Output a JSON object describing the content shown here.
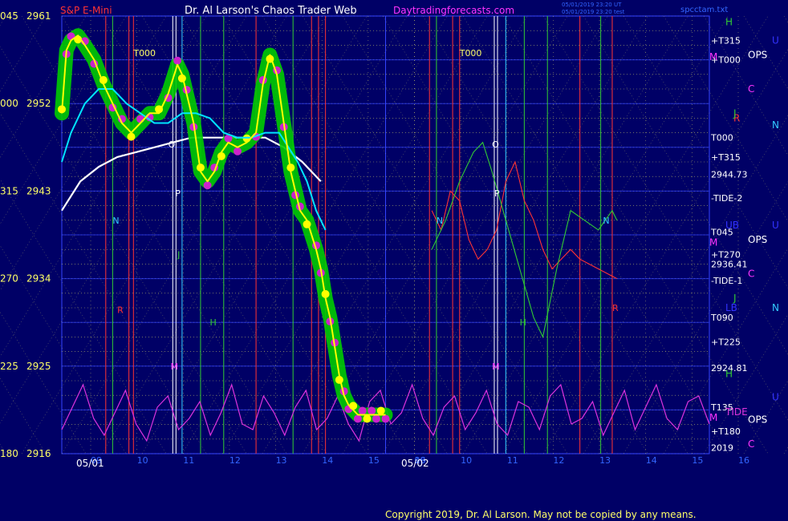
{
  "header": {
    "symbol": "S&P E-Mini",
    "title": "Dr. Al Larson's Chaos Trader Web",
    "site": "Daytradingforecasts.com",
    "stamp1": "05/01/2019 23:20 UT",
    "stamp2": "05/01/2019 23:20 test",
    "file": "spcctam.txt"
  },
  "footer": {
    "copyright": "Copyright 2019, Dr. Al Larson. May not be copied by any means."
  },
  "colors": {
    "background": "#000066",
    "price": "#ffff00",
    "price_glow": "#00cc00",
    "dots_magenta": "#cc22cc",
    "dots_yellow": "#ffff00",
    "ma_fast": "#00e5ff",
    "ma_slow": "#ffffff",
    "tide1": "#ff3333",
    "tide2": "#33cc33",
    "tide": "#dd33dd",
    "grid_yellow": "#ffff66",
    "grid_blue": "#3344ff",
    "axis_text": "#ffff66",
    "site_text": "#ff33ff"
  },
  "chart_data": {
    "type": "line",
    "title": "S&P E-Mini",
    "ylim": [
      2916,
      2961
    ],
    "y_ticks": [
      {
        "left": "045",
        "value": "2961"
      },
      {
        "left": "000",
        "value": "2952"
      },
      {
        "left": "315",
        "value": "2943"
      },
      {
        "left": "270",
        "value": "2934"
      },
      {
        "left": "225",
        "value": "2925"
      },
      {
        "left": "180",
        "value": "2916"
      }
    ],
    "x_hours": [
      9,
      10,
      11,
      12,
      13,
      14,
      15,
      16,
      9,
      10,
      11,
      12,
      13,
      14,
      15,
      16
    ],
    "x_hour_labels": [
      "09",
      "10",
      "11",
      "12",
      "13",
      "14",
      "15",
      "16",
      "09",
      "10",
      "11",
      "12",
      "13",
      "14",
      "15",
      "16"
    ],
    "x_dates": [
      "05/01",
      "05/02"
    ],
    "series": [
      {
        "name": "price",
        "x": [
          0,
          0.1,
          0.2,
          0.35,
          0.5,
          0.7,
          0.9,
          1.1,
          1.3,
          1.5,
          1.7,
          1.9,
          2.1,
          2.3,
          2.5,
          2.6,
          2.7,
          2.85,
          3.0,
          3.15,
          3.3,
          3.45,
          3.6,
          3.8,
          4.0,
          4.2,
          4.35,
          4.5,
          4.65,
          4.8,
          4.95,
          5.05,
          5.15,
          5.3,
          5.5,
          5.6,
          5.7,
          5.8,
          5.9,
          6.0,
          6.1,
          6.2,
          6.3,
          6.4,
          6.5,
          6.6,
          6.7,
          6.8,
          6.9,
          7.0
        ],
        "y": [
          2951,
          2957.5,
          2958.5,
          2959,
          2958,
          2956.5,
          2954,
          2952,
          2950,
          2949,
          2950,
          2951,
          2951,
          2953,
          2956,
          2955,
          2953,
          2950,
          2945,
          2944,
          2945,
          2947,
          2948,
          2947.5,
          2948,
          2949,
          2954,
          2957,
          2955,
          2950,
          2945,
          2943,
          2941,
          2940,
          2937,
          2935,
          2932,
          2930,
          2927,
          2924,
          2922,
          2921,
          2920.5,
          2920,
          2920,
          2920,
          2920,
          2920,
          2920,
          2920
        ]
      },
      {
        "name": "ma_fast",
        "x": [
          0,
          0.2,
          0.5,
          0.8,
          1.1,
          1.4,
          1.7,
          2.0,
          2.3,
          2.6,
          2.9,
          3.2,
          3.5,
          3.8,
          4.1,
          4.4,
          4.7,
          4.9,
          5.1,
          5.3,
          5.5,
          5.7
        ],
        "y": [
          2946,
          2949,
          2952,
          2953.5,
          2953.5,
          2952,
          2951,
          2950,
          2950,
          2951,
          2951,
          2950.5,
          2949,
          2948.5,
          2948.5,
          2949,
          2949,
          2947.5,
          2946,
          2944,
          2941,
          2939
        ]
      },
      {
        "name": "ma_slow",
        "x": [
          0,
          0.4,
          0.8,
          1.2,
          1.6,
          2.0,
          2.4,
          2.8,
          3.2,
          3.6,
          4.0,
          4.4,
          4.8,
          5.2,
          5.6
        ],
        "y": [
          2941,
          2944,
          2945.5,
          2946.5,
          2947,
          2947.5,
          2948,
          2948.5,
          2948.5,
          2948.5,
          2948.5,
          2948.5,
          2947.5,
          2946,
          2944
        ]
      },
      {
        "name": "TIDE-1",
        "x": [
          8,
          8.2,
          8.4,
          8.6,
          8.8,
          9.0,
          9.2,
          9.4,
          9.6,
          9.8,
          10.0,
          10.2,
          10.4,
          10.6,
          10.8,
          11.0,
          11.2,
          11.4,
          11.6,
          11.8,
          12.0
        ],
        "y": [
          2941,
          2939,
          2943,
          2942,
          2938,
          2936,
          2937,
          2939,
          2944,
          2946,
          2942,
          2940,
          2937,
          2935,
          2936,
          2937,
          2936,
          2935.5,
          2935,
          2934.5,
          2934
        ]
      },
      {
        "name": "TIDE-2",
        "x": [
          8,
          8.3,
          8.6,
          8.9,
          9.1,
          9.3,
          9.6,
          9.9,
          10.2,
          10.4,
          10.7,
          11.0,
          11.3,
          11.6,
          11.9,
          12.0
        ],
        "y": [
          2937,
          2940,
          2944,
          2947,
          2948,
          2945,
          2940,
          2935,
          2930,
          2928,
          2935,
          2941,
          2940,
          2939,
          2941,
          2940
        ]
      }
    ],
    "tide_wave": {
      "name": "TIDE",
      "values": [
        0.2,
        0.6,
        1.0,
        0.4,
        0.1,
        0.5,
        0.9,
        0.3,
        0.0,
        0.6,
        0.8,
        0.2,
        0.4,
        0.7,
        0.1,
        0.5,
        1.0,
        0.3,
        0.2,
        0.8,
        0.5,
        0.1,
        0.6,
        0.9,
        0.2,
        0.4,
        0.8,
        0.3,
        0.0,
        0.7,
        0.9,
        0.3,
        0.5,
        1.0,
        0.4,
        0.1,
        0.6,
        0.8,
        0.2,
        0.5,
        0.9,
        0.3,
        0.1,
        0.7,
        0.6,
        0.2,
        0.8,
        1.0,
        0.3,
        0.4,
        0.7,
        0.1,
        0.5,
        0.9,
        0.2,
        0.6,
        1.0,
        0.4,
        0.2,
        0.7,
        0.8,
        0.3
      ]
    },
    "right_labels": [
      {
        "text": "+T315",
        "value": 2958.5
      },
      {
        "text": "+T000",
        "value": 2956.5
      },
      {
        "text": "T000",
        "value": 2948.5
      },
      {
        "text": "+T315",
        "value": 2946.5
      },
      {
        "text": "2944.73",
        "value": 2944.73
      },
      {
        "text": "-TIDE-2",
        "value": 2942.3
      },
      {
        "text": "T045",
        "value": 2938.8
      },
      {
        "text": "+T270",
        "value": 2936.5
      },
      {
        "text": "2936.41",
        "value": 2935.5
      },
      {
        "text": "-TIDE-1",
        "value": 2933.8
      },
      {
        "text": "T090",
        "value": 2930
      },
      {
        "text": "+T225",
        "value": 2927.5
      },
      {
        "text": "2924.81",
        "value": 2924.81
      },
      {
        "text": "T135",
        "value": 2920.8
      },
      {
        "text": "+T180",
        "value": 2918.3
      },
      {
        "text": "2019",
        "value": 2916.6
      }
    ],
    "far_right_letters": [
      {
        "text": "H",
        "value": 2960.4,
        "color": "#33cc33"
      },
      {
        "text": "U",
        "value": 2958.5,
        "color": "#3333ff"
      },
      {
        "text": "M",
        "value": 2956.8,
        "color": "#ff33ff"
      },
      {
        "text": "OPS",
        "value": 2957,
        "color": "#ffffff"
      },
      {
        "text": "C",
        "value": 2953.5,
        "color": "#ff33ff"
      },
      {
        "text": "R",
        "value": 2950.5,
        "color": "#ff3333"
      },
      {
        "text": "J",
        "value": 2951,
        "color": "#33cc33"
      },
      {
        "text": "N",
        "value": 2949.8,
        "color": "#33ccff"
      },
      {
        "text": "UB",
        "value": 2939.5,
        "color": "#3333ff"
      },
      {
        "text": "U",
        "value": 2939.5,
        "color": "#3333ff"
      },
      {
        "text": "M",
        "value": 2937.7,
        "color": "#ff33ff"
      },
      {
        "text": "OPS",
        "value": 2938,
        "color": "#ffffff"
      },
      {
        "text": "C",
        "value": 2934.5,
        "color": "#ff33ff"
      },
      {
        "text": "J",
        "value": 2932,
        "color": "#33cc33"
      },
      {
        "text": "LB",
        "value": 2931,
        "color": "#3333ff"
      },
      {
        "text": "N",
        "value": 2931,
        "color": "#33ccff"
      },
      {
        "text": "H",
        "value": 2924.2,
        "color": "#33cc33"
      },
      {
        "text": "U",
        "value": 2921.8,
        "color": "#3333ff"
      },
      {
        "text": "TIDE",
        "value": 2920.3,
        "color": "#dd33dd"
      },
      {
        "text": "M",
        "value": 2919.7,
        "color": "#ff33ff"
      },
      {
        "text": "OPS",
        "value": 2919.5,
        "color": "#ffffff"
      },
      {
        "text": "C",
        "value": 2917,
        "color": "#ff33ff"
      }
    ],
    "in_chart_letters": [
      {
        "text": "T000",
        "x": 1.55,
        "value": 2957.2,
        "color": "#ffff66"
      },
      {
        "text": "T000",
        "x": 8.6,
        "value": 2957.2,
        "color": "#ffff66"
      },
      {
        "text": "O",
        "x": 2.3,
        "value": 2947.8,
        "color": "#ffffff"
      },
      {
        "text": "O",
        "x": 9.3,
        "value": 2947.8,
        "color": "#ffffff"
      },
      {
        "text": "P",
        "x": 2.45,
        "value": 2942.8,
        "color": "#ffffff"
      },
      {
        "text": "P",
        "x": 9.35,
        "value": 2942.8,
        "color": "#ffffff"
      },
      {
        "text": "N",
        "x": 1.1,
        "value": 2940,
        "color": "#33ccff"
      },
      {
        "text": "N",
        "x": 8.1,
        "value": 2940,
        "color": "#33ccff"
      },
      {
        "text": "N",
        "x": 11.7,
        "value": 2940,
        "color": "#33ccff"
      },
      {
        "text": "J",
        "x": 2.5,
        "value": 2936.5,
        "color": "#33cc33"
      },
      {
        "text": "R",
        "x": 1.2,
        "value": 2930.8,
        "color": "#ff3333"
      },
      {
        "text": "H",
        "x": 3.2,
        "value": 2929.5,
        "color": "#33cc33"
      },
      {
        "text": "H",
        "x": 9.9,
        "value": 2929.5,
        "color": "#33cc33"
      },
      {
        "text": "M",
        "x": 2.35,
        "value": 2925,
        "color": "#ff33ff"
      },
      {
        "text": "M",
        "x": 9.3,
        "value": 2925,
        "color": "#ff33ff"
      },
      {
        "text": "R",
        "x": 11.9,
        "value": 2931,
        "color": "#ff3333"
      }
    ],
    "vlines": [
      {
        "x": 0.95,
        "color": "#ff3333"
      },
      {
        "x": 1.1,
        "color": "#33cc33"
      },
      {
        "x": 1.45,
        "color": "#ff3333"
      },
      {
        "x": 1.55,
        "color": "#ff3333"
      },
      {
        "x": 2.4,
        "color": "#ffffff"
      },
      {
        "x": 2.47,
        "color": "#ffffff"
      },
      {
        "x": 2.6,
        "color": "#33ccff"
      },
      {
        "x": 3.0,
        "color": "#33cc33"
      },
      {
        "x": 3.5,
        "color": "#33cc33"
      },
      {
        "x": 4.2,
        "color": "#ff3333"
      },
      {
        "x": 5.0,
        "color": "#33cc33"
      },
      {
        "x": 5.4,
        "color": "#ff3333"
      },
      {
        "x": 5.55,
        "color": "#ff3333"
      },
      {
        "x": 5.7,
        "color": "#ff3333"
      },
      {
        "x": 7.95,
        "color": "#ff3333"
      },
      {
        "x": 8.1,
        "color": "#33cc33"
      },
      {
        "x": 8.45,
        "color": "#ff3333"
      },
      {
        "x": 8.6,
        "color": "#ff3333"
      },
      {
        "x": 9.35,
        "color": "#ffffff"
      },
      {
        "x": 9.42,
        "color": "#ffffff"
      },
      {
        "x": 9.6,
        "color": "#33ccff"
      },
      {
        "x": 10.0,
        "color": "#33cc33"
      },
      {
        "x": 10.5,
        "color": "#33cc33"
      },
      {
        "x": 11.2,
        "color": "#ff3333"
      },
      {
        "x": 11.65,
        "color": "#33cc33"
      },
      {
        "x": 11.9,
        "color": "#ff3333"
      }
    ]
  }
}
